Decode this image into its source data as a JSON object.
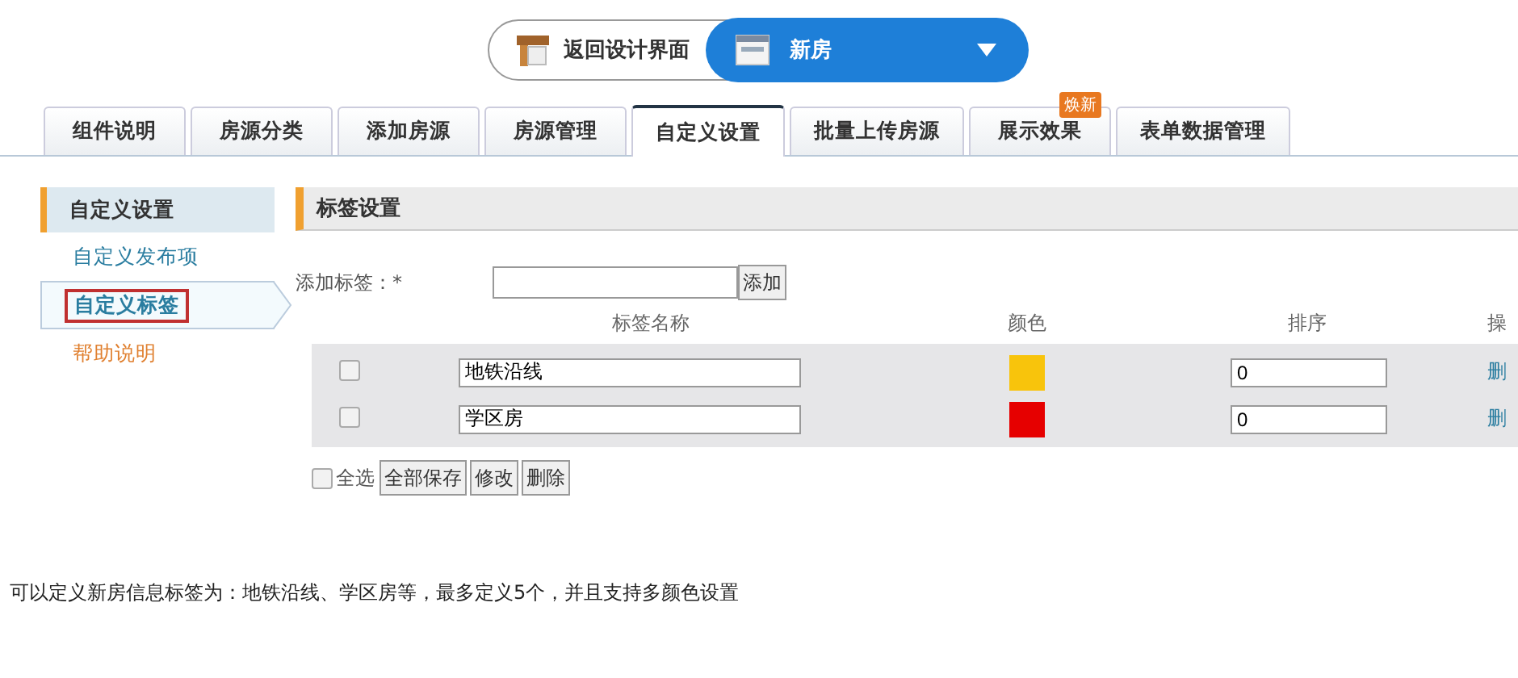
{
  "top_bar": {
    "back_button": "返回设计界面",
    "dropdown": {
      "value": "新房"
    }
  },
  "tabs": [
    {
      "label": "组件说明",
      "selected": false
    },
    {
      "label": "房源分类",
      "selected": false
    },
    {
      "label": "添加房源",
      "selected": false
    },
    {
      "label": "房源管理",
      "selected": false
    },
    {
      "label": "自定义设置",
      "selected": true
    },
    {
      "label": "批量上传房源",
      "selected": false
    },
    {
      "label": "展示效果",
      "selected": false,
      "badge": "焕新"
    },
    {
      "label": "表单数据管理",
      "selected": false
    }
  ],
  "sidebar": {
    "items": [
      {
        "kind": "heading",
        "label": "自定义设置"
      },
      {
        "kind": "link",
        "label": "自定义发布项",
        "selected": false
      },
      {
        "kind": "link",
        "label": "自定义标签",
        "selected": true
      },
      {
        "kind": "help",
        "label": "帮助说明",
        "selected": false
      }
    ]
  },
  "panel": {
    "title": "标签设置",
    "add_label": "添加标签：*",
    "add_button": "添加",
    "columns": [
      "标签名称",
      "颜色",
      "排序",
      "操"
    ],
    "rows": [
      {
        "checked": false,
        "name": "地铁沿线",
        "color": "#f8c40c",
        "order": "0",
        "action": "删"
      },
      {
        "checked": false,
        "name": "学区房",
        "color": "#e60000",
        "order": "0",
        "action": "删"
      }
    ],
    "select_all": {
      "label": "全选",
      "checked": false
    },
    "buttons": [
      "全部保存",
      "修改",
      "删除"
    ]
  },
  "note": "可以定义新房信息标签为：地铁沿线、学区房等，最多定义5个，并且支持多颜色设置"
}
